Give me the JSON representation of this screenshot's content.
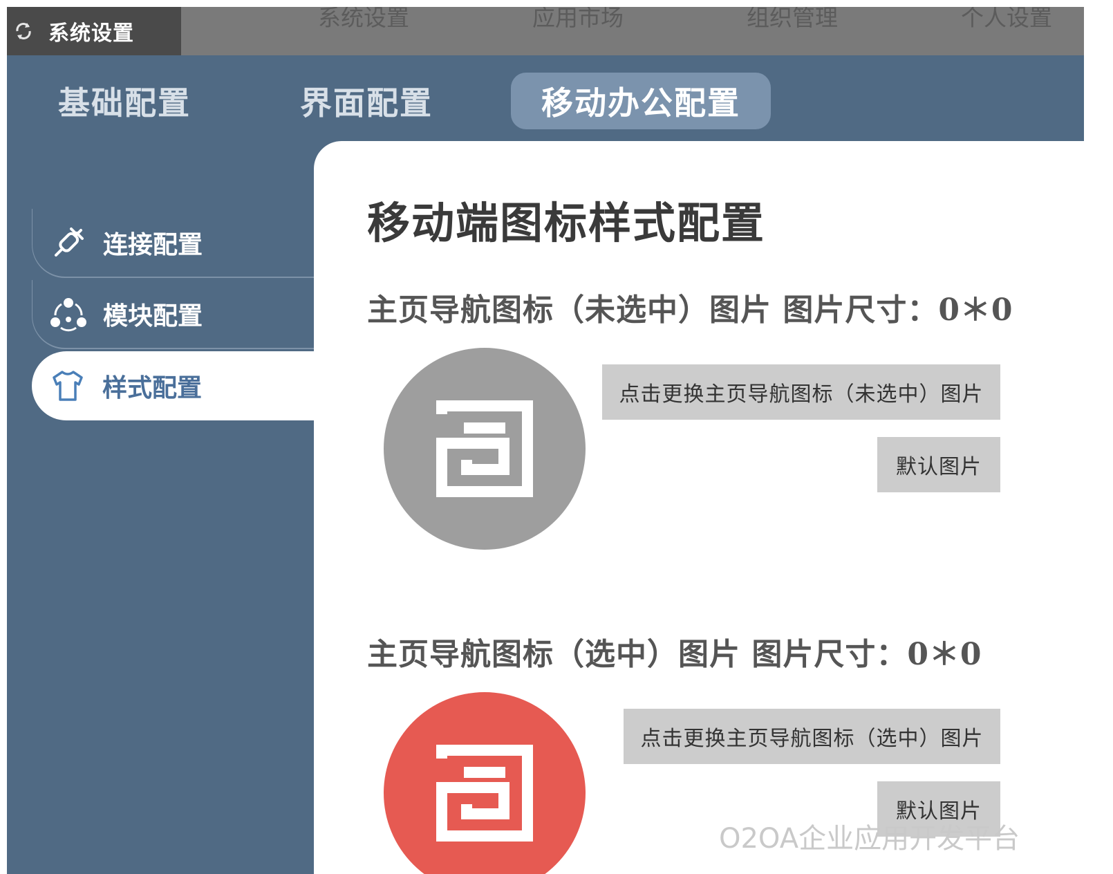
{
  "window": {
    "title": "系统设置",
    "icon": "refresh-icon"
  },
  "top_nav": [
    "系统设置",
    "应用市场",
    "组织管理",
    "个人设置"
  ],
  "tabs": [
    {
      "label": "基础配置",
      "active": false
    },
    {
      "label": "界面配置",
      "active": false
    },
    {
      "label": "移动办公配置",
      "active": true
    }
  ],
  "sidebar": {
    "items": [
      {
        "label": "连接配置",
        "icon": "plug-icon",
        "active": false
      },
      {
        "label": "模块配置",
        "icon": "modules-icon",
        "active": false
      },
      {
        "label": "样式配置",
        "icon": "shirt-icon",
        "active": true
      }
    ]
  },
  "main": {
    "title": "移动端图标样式配置",
    "sections": [
      {
        "label": "主页导航图标（未选中）图片 图片尺寸：0＊0",
        "preview_color": "#9e9e9e",
        "change_button": "点击更换主页导航图标（未选中）图片",
        "default_button": "默认图片"
      },
      {
        "label": "主页导航图标（选中）图片 图片尺寸：0＊0",
        "preview_color": "#e65a52",
        "change_button": "点击更换主页导航图标（选中）图片",
        "default_button": "默认图片"
      }
    ]
  },
  "watermark": "O2OA企业应用开发平台",
  "colors": {
    "app_bg": "#506a84",
    "active_tab": "#7b93ad",
    "active_side_text": "#4a6f9a",
    "button_bg": "#cccccc"
  }
}
